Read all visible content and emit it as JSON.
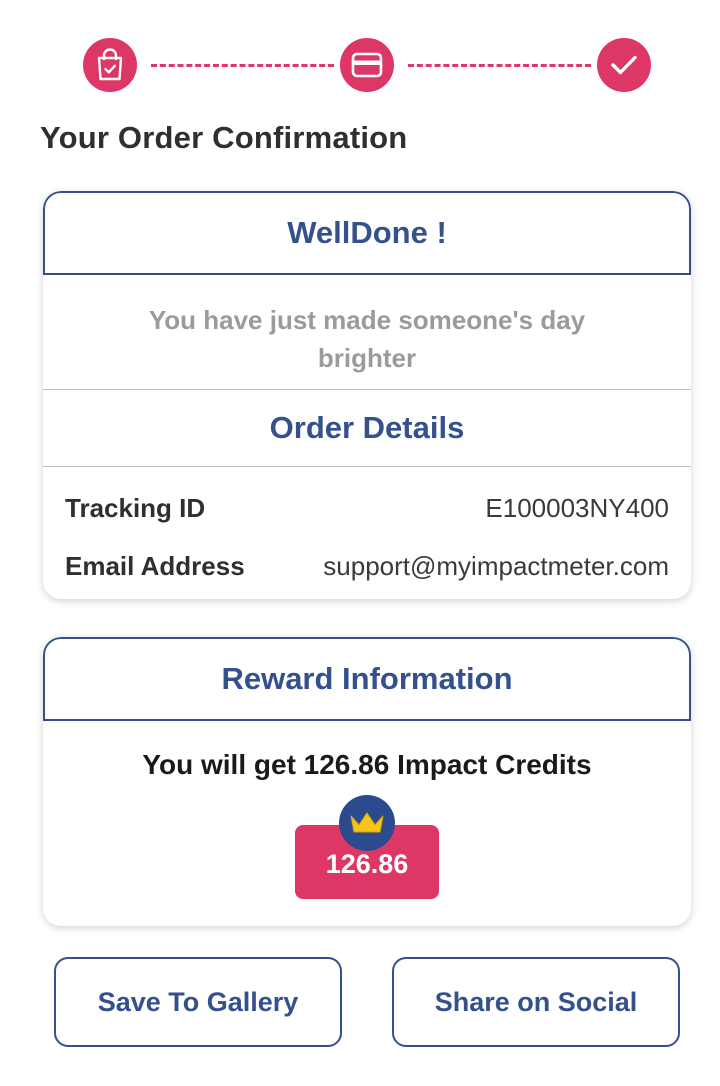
{
  "stepper": {
    "steps": [
      {
        "icon": "shopping-bag-check-icon",
        "status": "done"
      },
      {
        "icon": "credit-card-icon",
        "status": "done"
      },
      {
        "icon": "checkmark-icon",
        "status": "done"
      }
    ]
  },
  "page": {
    "title": "Your Order Confirmation"
  },
  "confirmation": {
    "heading": "WellDone !",
    "message": "You have just made someone's day brighter",
    "details_title": "Order Details",
    "tracking_label": "Tracking ID",
    "tracking_value": "E100003NY400",
    "email_label": "Email Address",
    "email_value": "support@myimpactmeter.com"
  },
  "reward": {
    "heading": "Reward Information",
    "text": "You will get 126.86 Impact Credits",
    "badge_value": "126.86",
    "badge_icon": "crown-icon"
  },
  "actions": {
    "save_label": "Save To Gallery",
    "share_label": "Share on Social"
  },
  "colors": {
    "accent_pink": "#dd3766",
    "brand_blue": "#34508d",
    "crown_blue": "#2c4a8e",
    "crown_gold": "#f5c518",
    "muted_text": "#9b9b9b"
  }
}
